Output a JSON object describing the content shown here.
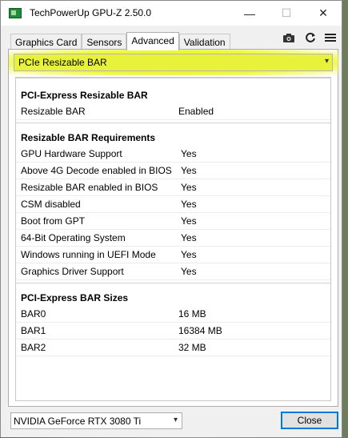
{
  "window": {
    "title": "TechPowerUp GPU-Z 2.50.0",
    "minimize_glyph": "—",
    "maximize_glyph": "☐",
    "close_glyph": "✕"
  },
  "tabs": [
    {
      "label": "Graphics Card",
      "active": false
    },
    {
      "label": "Sensors",
      "active": false
    },
    {
      "label": "Advanced",
      "active": true
    },
    {
      "label": "Validation",
      "active": false
    }
  ],
  "toolbar_icons": [
    "camera-icon",
    "refresh-icon",
    "menu-icon"
  ],
  "dropdown": {
    "selected": "PCIe Resizable BAR",
    "highlight_color": "#e8f23a"
  },
  "sections": {
    "rebar": {
      "title": "PCI-Express Resizable BAR",
      "rows": [
        {
          "label": "Resizable BAR",
          "value": "Enabled"
        }
      ]
    },
    "requirements": {
      "title": "Resizable BAR Requirements",
      "rows": [
        {
          "label": "GPU Hardware Support",
          "value": "Yes"
        },
        {
          "label": "Above 4G Decode enabled in BIOS",
          "value": "Yes"
        },
        {
          "label": "Resizable BAR enabled in BIOS",
          "value": "Yes"
        },
        {
          "label": "CSM disabled",
          "value": "Yes"
        },
        {
          "label": "Boot from GPT",
          "value": "Yes"
        },
        {
          "label": "64-Bit Operating System",
          "value": "Yes"
        },
        {
          "label": "Windows running in UEFI Mode",
          "value": "Yes"
        },
        {
          "label": "Graphics Driver Support",
          "value": "Yes"
        }
      ]
    },
    "bar_sizes": {
      "title": "PCI-Express BAR Sizes",
      "rows": [
        {
          "label": "BAR0",
          "value": "16 MB"
        },
        {
          "label": "BAR1",
          "value": "16384 MB"
        },
        {
          "label": "BAR2",
          "value": "32 MB"
        }
      ]
    }
  },
  "bottom": {
    "gpu_selected": "NVIDIA GeForce RTX 3080 Ti",
    "close_label": "Close",
    "accent_color": "#0078d7"
  }
}
